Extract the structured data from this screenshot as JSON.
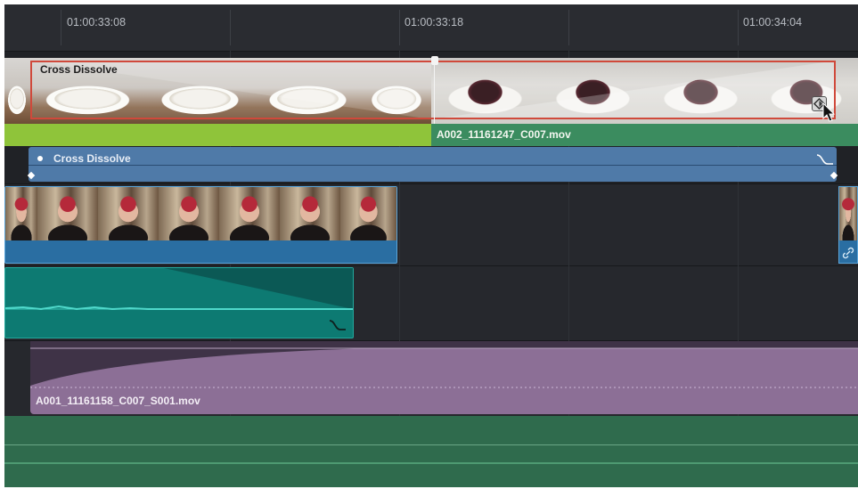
{
  "ruler": {
    "timecodes": [
      "01:00:33:08",
      "01:00:33:18",
      "01:00:34:04"
    ]
  },
  "video_track_1": {
    "transition_label": "Cross Dissolve",
    "clip_name": "A002_11161247_C007.mov"
  },
  "effect_track": {
    "effect_label": "Cross Dissolve"
  },
  "purple_track": {
    "clip_name": "A001_11161158_C007_S001.mov"
  },
  "colors": {
    "timeline_bg": "#1f2125",
    "green_clip": "#8fc43a",
    "teal_clip": "#3b8c5f",
    "effect_blue": "#4f7aa8",
    "audio_teal": "#0d7a72",
    "purple_clip": "#8c6f96",
    "dissolve_border": "#d0493b"
  }
}
